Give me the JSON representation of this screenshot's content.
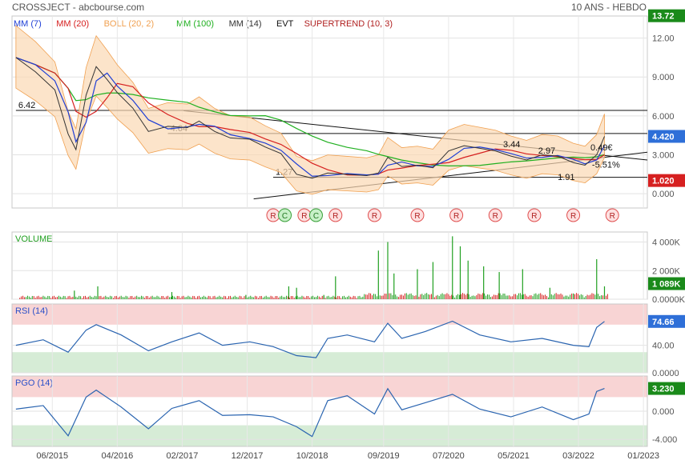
{
  "header": {
    "title": "CROSSJECT - abcbourse.com",
    "period": "10 ANS - HEBDO"
  },
  "legend": [
    {
      "label": "MM (7)",
      "color": "#1f3fd6"
    },
    {
      "label": "MM (20)",
      "color": "#d62020"
    },
    {
      "label": "BOLL (20, 2)",
      "color": "#f0a050"
    },
    {
      "label": "MM (100)",
      "color": "#20b020"
    },
    {
      "label": "MM (14)",
      "color": "#333333"
    },
    {
      "label": "EVT",
      "color": "#111111"
    },
    {
      "label": "SUPERTREND (10, 3)",
      "color": "#b02020"
    }
  ],
  "chart_data": [
    {
      "type": "line",
      "name": "price",
      "yticks": [
        "12.00",
        "9.000",
        "6.000",
        "3.000",
        "0.000"
      ],
      "yvals": [
        12,
        9,
        6,
        3,
        0
      ],
      "ylim": [
        -1.1,
        13.7
      ],
      "x": [
        "06/2015",
        "04/2016",
        "02/2017",
        "12/2017",
        "10/2018",
        "09/2019",
        "07/2020",
        "05/2021",
        "03/2022",
        "01/2023"
      ],
      "xlim": [
        2014.9,
        2023.05
      ],
      "series": [
        {
          "values": [
            [
              2014.95,
              10.5
            ],
            [
              2015.2,
              9.4
            ],
            [
              2015.45,
              8.0
            ],
            [
              2015.62,
              4.6
            ],
            [
              2015.72,
              3.4
            ],
            [
              2015.85,
              7.6
            ],
            [
              2015.98,
              9.8
            ],
            [
              2016.12,
              8.8
            ],
            [
              2016.25,
              7.8
            ],
            [
              2016.45,
              6.6
            ],
            [
              2016.65,
              4.8
            ],
            [
              2016.9,
              5.2
            ],
            [
              2017.15,
              5.1
            ],
            [
              2017.3,
              5.6
            ],
            [
              2017.5,
              4.8
            ],
            [
              2017.7,
              4.3
            ],
            [
              2017.95,
              4.2
            ],
            [
              2018.15,
              3.6
            ],
            [
              2018.35,
              3.1
            ],
            [
              2018.55,
              1.5
            ],
            [
              2018.75,
              1.2
            ],
            [
              2018.95,
              1.6
            ],
            [
              2019.2,
              1.5
            ],
            [
              2019.45,
              1.4
            ],
            [
              2019.6,
              1.6
            ],
            [
              2019.72,
              2.8
            ],
            [
              2019.9,
              2.1
            ],
            [
              2020.1,
              2.2
            ],
            [
              2020.3,
              2.0
            ],
            [
              2020.5,
              3.3
            ],
            [
              2020.7,
              3.7
            ],
            [
              2020.9,
              3.5
            ],
            [
              2021.1,
              3.3
            ],
            [
              2021.3,
              2.9
            ],
            [
              2021.5,
              2.6
            ],
            [
              2021.7,
              3.0
            ],
            [
              2021.9,
              2.9
            ],
            [
              2022.1,
              2.4
            ],
            [
              2022.25,
              2.2
            ],
            [
              2022.4,
              3.0
            ],
            [
              2022.5,
              4.42
            ]
          ]
        }
      ],
      "reference_levels": [
        {
          "value": 6.42,
          "label": "6.42"
        },
        {
          "value": 4.64,
          "label": "4.64"
        },
        {
          "value": 1.27,
          "label": "1.27"
        }
      ],
      "annotations": [
        "3.44",
        "2.97",
        "0.49€",
        "-5.51%",
        "1.91"
      ],
      "markers": [
        {
          "x": 2018.25,
          "label": "R"
        },
        {
          "x": 2018.4,
          "label": "C"
        },
        {
          "x": 2018.65,
          "label": "R"
        },
        {
          "x": 2018.8,
          "label": "C"
        },
        {
          "x": 2019.05,
          "label": "R"
        },
        {
          "x": 2019.55,
          "label": "R"
        },
        {
          "x": 2020.1,
          "label": "R"
        },
        {
          "x": 2020.6,
          "label": "R"
        },
        {
          "x": 2021.1,
          "label": "R"
        },
        {
          "x": 2021.6,
          "label": "R"
        },
        {
          "x": 2022.1,
          "label": "R"
        },
        {
          "x": 2022.6,
          "label": "R"
        }
      ],
      "badges": [
        {
          "value": 13.72,
          "label": "13.72",
          "color": "#1a8a1a"
        },
        {
          "value": 4.42,
          "label": "4.420",
          "color": "#2e6fd8"
        },
        {
          "value": 1.02,
          "label": "1.020",
          "color": "#d62020"
        }
      ]
    },
    {
      "type": "bar",
      "name": "volume",
      "title": "VOLUME",
      "yticks": [
        "4 000K",
        "2 000K",
        "0.0000K"
      ],
      "yvals": [
        4000,
        2000,
        0
      ],
      "ylim": [
        0,
        4700
      ],
      "spikes": [
        [
          2015.7,
          600
        ],
        [
          2016.0,
          900
        ],
        [
          2016.95,
          500
        ],
        [
          2017.9,
          300
        ],
        [
          2018.45,
          900
        ],
        [
          2018.55,
          800
        ],
        [
          2018.9,
          300
        ],
        [
          2019.05,
          1600
        ],
        [
          2019.6,
          3400
        ],
        [
          2019.72,
          4000
        ],
        [
          2019.8,
          1800
        ],
        [
          2020.1,
          2100
        ],
        [
          2020.3,
          2600
        ],
        [
          2020.55,
          4400
        ],
        [
          2020.65,
          3700
        ],
        [
          2020.75,
          2700
        ],
        [
          2020.95,
          2300
        ],
        [
          2021.15,
          1900
        ],
        [
          2021.45,
          2100
        ],
        [
          2021.8,
          800
        ],
        [
          2022.1,
          400
        ],
        [
          2022.4,
          2800
        ],
        [
          2022.5,
          900
        ]
      ],
      "badges": [
        {
          "value": 1089,
          "label": "1 089K",
          "color": "#1a8a1a"
        }
      ]
    },
    {
      "type": "line",
      "name": "RSI",
      "title": "RSI (14)",
      "yticks": [
        "40.00",
        "0.0000"
      ],
      "yvals": [
        40,
        0
      ],
      "ylim": [
        0,
        100
      ],
      "zones": [
        {
          "from": 70,
          "to": 100,
          "color": "#f8d4d4"
        },
        {
          "from": 0,
          "to": 30,
          "color": "#d6ecd6"
        }
      ],
      "series": [
        {
          "values": [
            [
              2014.95,
              40
            ],
            [
              2015.3,
              48
            ],
            [
              2015.62,
              30
            ],
            [
              2015.85,
              62
            ],
            [
              2015.98,
              70
            ],
            [
              2016.3,
              55
            ],
            [
              2016.65,
              32
            ],
            [
              2016.95,
              45
            ],
            [
              2017.3,
              58
            ],
            [
              2017.6,
              40
            ],
            [
              2017.95,
              45
            ],
            [
              2018.25,
              38
            ],
            [
              2018.55,
              25
            ],
            [
              2018.8,
              22
            ],
            [
              2018.95,
              50
            ],
            [
              2019.2,
              55
            ],
            [
              2019.55,
              45
            ],
            [
              2019.72,
              72
            ],
            [
              2019.9,
              50
            ],
            [
              2020.2,
              60
            ],
            [
              2020.55,
              75
            ],
            [
              2020.9,
              55
            ],
            [
              2021.3,
              45
            ],
            [
              2021.7,
              50
            ],
            [
              2022.1,
              40
            ],
            [
              2022.3,
              38
            ],
            [
              2022.4,
              66
            ],
            [
              2022.5,
              74.66
            ]
          ]
        }
      ],
      "badges": [
        {
          "value": 74.66,
          "label": "74.66",
          "color": "#2e6fd8"
        }
      ]
    },
    {
      "type": "line",
      "name": "PGO",
      "title": "PGO (14)",
      "yticks": [
        "0.000",
        "-4.000"
      ],
      "yvals": [
        0,
        -4
      ],
      "ylim": [
        -5,
        5
      ],
      "zones": [
        {
          "from": 2,
          "to": 5,
          "color": "#f8d4d4"
        },
        {
          "from": -5,
          "to": -2,
          "color": "#d6ecd6"
        }
      ],
      "series": [
        {
          "values": [
            [
              2014.95,
              0.3
            ],
            [
              2015.3,
              0.8
            ],
            [
              2015.62,
              -3.5
            ],
            [
              2015.85,
              2.0
            ],
            [
              2015.98,
              3.0
            ],
            [
              2016.3,
              0.6
            ],
            [
              2016.65,
              -2.5
            ],
            [
              2016.95,
              0.4
            ],
            [
              2017.3,
              1.5
            ],
            [
              2017.6,
              -0.6
            ],
            [
              2017.95,
              -0.5
            ],
            [
              2018.25,
              -0.8
            ],
            [
              2018.55,
              -2.2
            ],
            [
              2018.75,
              -3.6
            ],
            [
              2018.95,
              1.5
            ],
            [
              2019.2,
              2.2
            ],
            [
              2019.55,
              -0.4
            ],
            [
              2019.72,
              3.2
            ],
            [
              2019.9,
              0.2
            ],
            [
              2020.2,
              1.2
            ],
            [
              2020.55,
              2.4
            ],
            [
              2020.9,
              0.3
            ],
            [
              2021.3,
              -0.8
            ],
            [
              2021.7,
              0.6
            ],
            [
              2022.1,
              -1.2
            ],
            [
              2022.3,
              -0.4
            ],
            [
              2022.4,
              2.8
            ],
            [
              2022.5,
              3.23
            ]
          ]
        }
      ],
      "badges": [
        {
          "value": 3.23,
          "label": "3.230",
          "color": "#1a8a1a"
        }
      ]
    }
  ]
}
